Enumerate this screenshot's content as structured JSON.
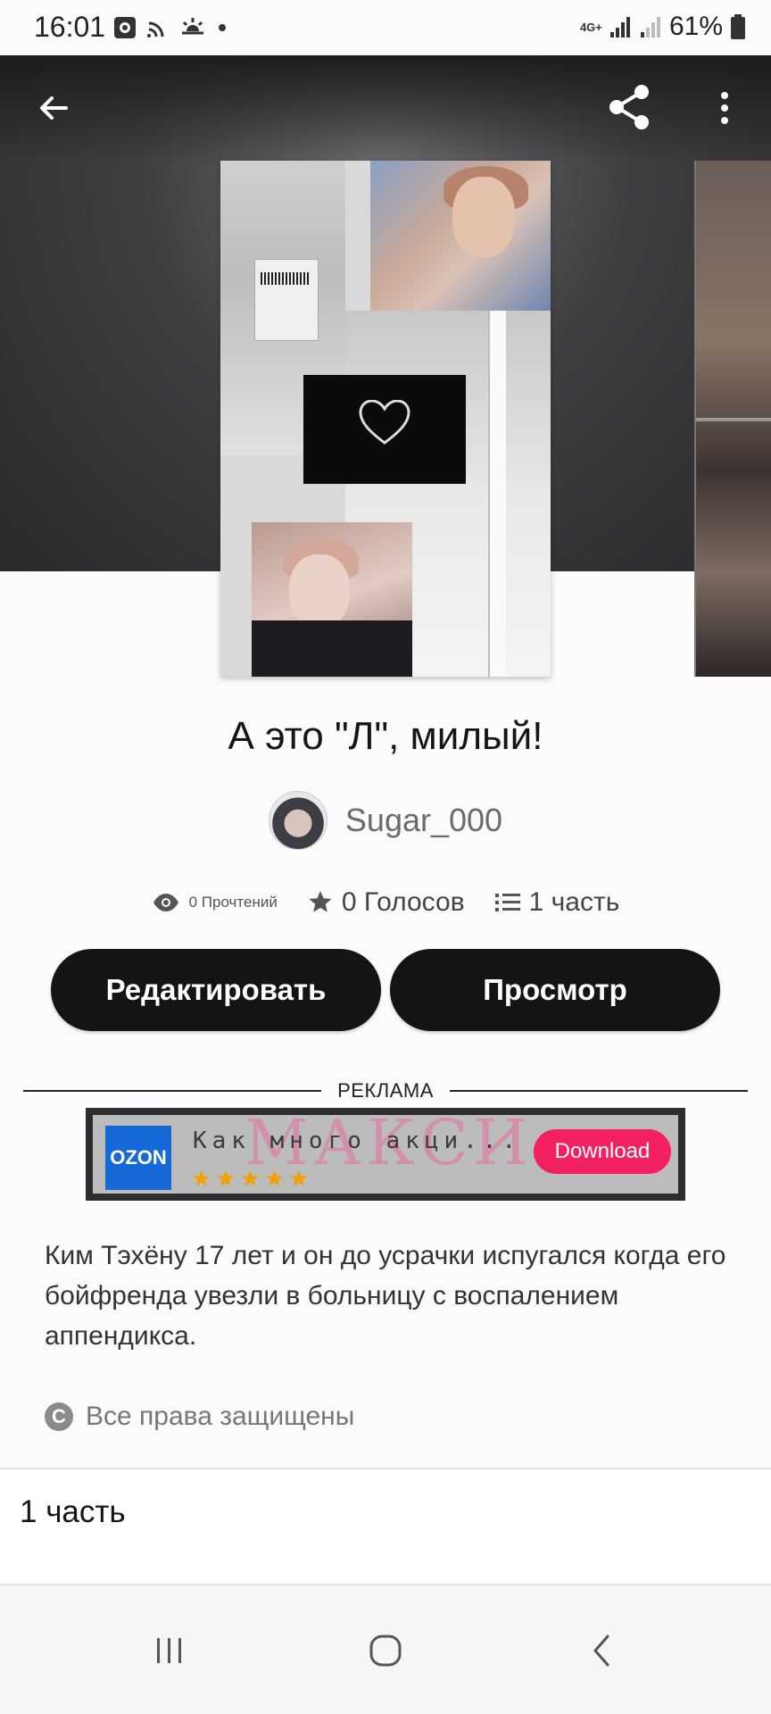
{
  "status_bar": {
    "time": "16:01",
    "network": "4G+",
    "battery": "61%",
    "icons": [
      "photo-icon",
      "cast-icon",
      "weather-icon",
      "dot-icon",
      "network-icon",
      "signal-icon",
      "signal-icon-2",
      "battery-icon"
    ]
  },
  "header": {
    "back_icon": "arrow-left-icon",
    "share_icon": "share-icon",
    "menu_icon": "more-vertical-icon"
  },
  "story": {
    "title": "А это \"Л\", милый!",
    "author": "Sugar_000",
    "stats": {
      "reads": "0 Прочтений",
      "votes": "0 Голосов",
      "parts": "1 часть"
    },
    "buttons": {
      "edit": "Редактировать",
      "view": "Просмотр"
    },
    "description": "Ким Тэхёну 17 лет и он до усрачки испугался когда его бойфренда увезли в больницу с воспалением аппендикса.",
    "rights": "Все права защищены"
  },
  "ad": {
    "label": "РЕКЛАМА",
    "brand": "OZON",
    "text": "Как много акци...",
    "stars": "★★★★★",
    "download": "Download"
  },
  "chapters": [
    {
      "label": "1 часть"
    }
  ],
  "navbar": {
    "recent_icon": "recent-apps-icon",
    "home_icon": "home-icon",
    "back_icon": "back-chevron-icon"
  }
}
